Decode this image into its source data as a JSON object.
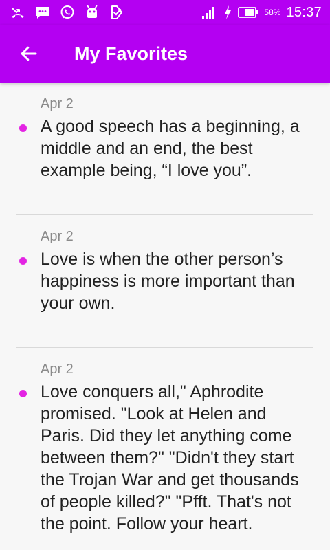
{
  "status_bar": {
    "icons": [
      "missed-call-icon",
      "message-icon",
      "whatsapp-icon",
      "android-icon",
      "check-list-icon"
    ],
    "right_icons": [
      "signal-icon",
      "charging-icon",
      "battery-icon"
    ],
    "battery_percent": "58%",
    "time": "15:37"
  },
  "app_bar": {
    "title": "My Favorites",
    "back_icon": "arrow-left-icon"
  },
  "colors": {
    "primary": "#b400f2",
    "bullet": "#e324e3",
    "date": "#8a8a8a",
    "text": "#222222",
    "divider": "#d9d9d9"
  },
  "quotes": [
    {
      "date": "Apr 2",
      "text": "A good speech has a beginning, a middle and an end, the best example being, “I love you”."
    },
    {
      "date": "Apr 2",
      "text": "Love is when the other person’s happiness is more important than your own."
    },
    {
      "date": "Apr 2",
      "text": "Love conquers all,\" Aphrodite promised. \"Look at Helen and Paris. Did they let anything come between them?\" \"Didn't they start the Trojan War and get thousands of people killed?\" \"Pfft. That's not the point. Follow your heart."
    }
  ]
}
